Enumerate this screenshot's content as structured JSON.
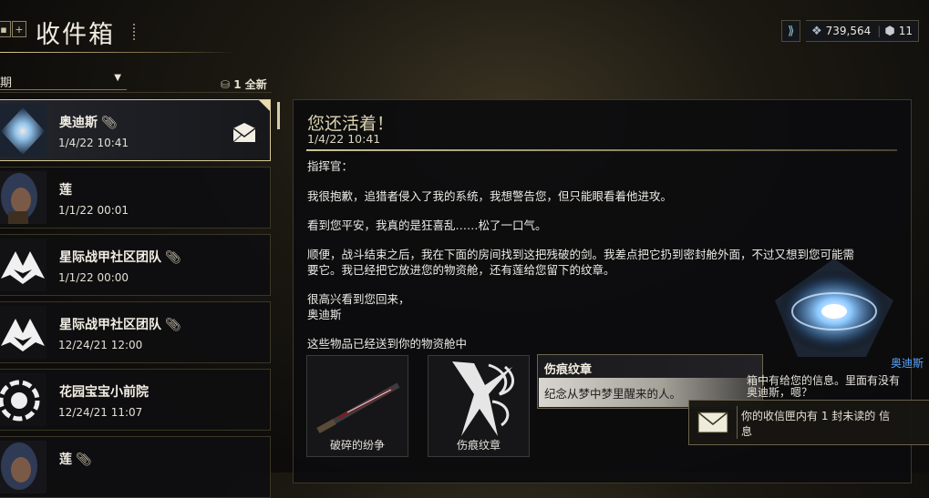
{
  "header": {
    "title": "收件箱",
    "add_label": "+"
  },
  "currency": {
    "credits": "739,564",
    "platinum": "11"
  },
  "list": {
    "sort_label": "期",
    "new_count": "1 全新",
    "items": [
      {
        "name": "奥迪斯",
        "date": "1/4/22 10:41",
        "attachment": true
      },
      {
        "name": "莲",
        "date": "1/1/22 00:01",
        "attachment": false
      },
      {
        "name": "星际战甲社区团队",
        "date": "1/1/22 00:00",
        "attachment": true
      },
      {
        "name": "星际战甲社区团队",
        "date": "12/24/21 12:00",
        "attachment": true
      },
      {
        "name": "花园宝宝小前院",
        "date": "12/24/21 11:07",
        "attachment": false
      },
      {
        "name": "莲",
        "date": "",
        "attachment": true
      }
    ]
  },
  "message": {
    "subject": "您还活着！",
    "date": "1/4/22 10:41",
    "greeting": "指挥官：",
    "para1": "我很抱歉，追猎者侵入了我的系统，我想警告您，但只能眼看着他进攻。",
    "para2": "看到您平安，我真的是狂喜乱……松了一口气。",
    "para3_line1": "顺便，战斗结束之后，我在下面的房间找到这把残破的剑。我差点把它扔到密封舱外面，不过又想到您可能需",
    "para3_line2": "要它。我已经把它放进您的物资舱，还有莲给您留下的纹章。",
    "closing": "很高兴看到您回来，",
    "signature": "奥迪斯",
    "attachments_note": "这些物品已经送到你的物资舱中",
    "attachments": [
      {
        "name": "破碎的纷争",
        "icon": "sword-icon"
      },
      {
        "name": "伤痕纹章",
        "icon": "sigil-icon"
      }
    ]
  },
  "tooltip": {
    "title": "伤痕纹章",
    "desc": "纪念从梦中梦里醒来的人。"
  },
  "ordis_popup": {
    "speaker": "奥迪斯",
    "line1": "箱中有给您的信息。里面有没有",
    "line2": "奥迪斯，嗯？"
  },
  "notice": {
    "line1": "你的收信匣内有 1 封未读的 信",
    "line2": "息"
  },
  "colors": {
    "accent": "#d6c896",
    "ordis_blue": "#5aa6ff"
  }
}
